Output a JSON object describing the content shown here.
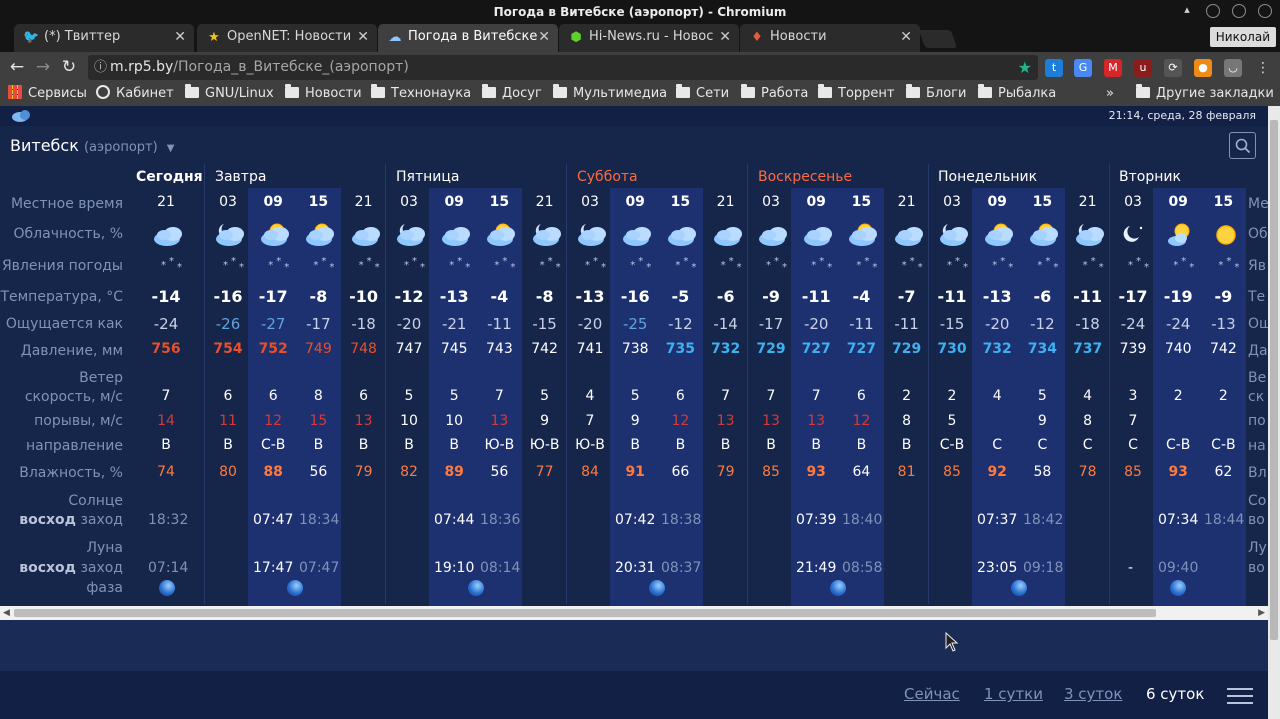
{
  "window": {
    "title": "Погода в Витебске (аэропорт) - Chromium"
  },
  "tabs": [
    {
      "label": "(*) Твиттер",
      "icon": "twitter-icon"
    },
    {
      "label": "OpenNET: Новости",
      "icon": "star-icon"
    },
    {
      "label": "Погода в Витебске",
      "icon": "weather-icon"
    },
    {
      "label": "Hi-News.ru - Новос",
      "icon": "hinews-icon"
    },
    {
      "label": "Новости",
      "icon": "rocket-icon"
    }
  ],
  "profile": {
    "name": "Николай"
  },
  "address": {
    "host": "m.rp5.by",
    "path": "/Погода_в_Витебске_(аэропорт)"
  },
  "bookmarks": {
    "apps": "Сервисы",
    "items": [
      "Кабинет",
      "GNU/Linux",
      "Новости",
      "Технонаука",
      "Досуг",
      "Мультимедиа",
      "Сети",
      "Работа",
      "Торрент",
      "Блоги",
      "Рыбалка"
    ],
    "more": "»",
    "other": "Другие закладки"
  },
  "page": {
    "datetime": "21:14, среда, 28 февраля",
    "city": "Витебск",
    "city_sub": "(аэропорт)",
    "labels": {
      "local_time": "Местное время",
      "clouds": "Облачность, %",
      "phenomena": "Явления погоды",
      "temperature": "Температура, °С",
      "feels": "Ощущается как",
      "pressure": "Давление, мм",
      "wind1": "Ветер",
      "wind2": "скорость, м/с",
      "gusts": "порывы, м/с",
      "direction": "направление",
      "humidity": "Влажность, %",
      "sun": "Солнце",
      "rise": "восход",
      "set": "заход",
      "moon": "Луна",
      "phase": "фаза"
    },
    "right_cut_labels": [
      "Ме",
      "Об",
      "Яв",
      "Те",
      "Ощ",
      "Да",
      "Ве",
      "ск",
      "по",
      "на",
      "Вл",
      "Со",
      "во",
      "Лу",
      "во"
    ]
  },
  "days": [
    {
      "name": "Сегодня",
      "weekend": false,
      "today": true,
      "sunrise": "",
      "sunset": "18:32",
      "moonrise": "",
      "moonset": "07:14",
      "slots": [
        {
          "h": "21",
          "t": "-14",
          "f": "-24",
          "p": "756",
          "w": "7",
          "g": "14",
          "d": "В",
          "hum": "74",
          "c": "cloudy"
        }
      ]
    },
    {
      "name": "Завтра",
      "weekend": false,
      "sunrise": "07:47",
      "sunset": "18:34",
      "moonrise": "17:47",
      "moonset": "07:47",
      "slots": [
        {
          "h": "03",
          "t": "-16",
          "f": "-26",
          "p": "754",
          "w": "6",
          "g": "11",
          "d": "В",
          "hum": "80",
          "c": "night-cloudy"
        },
        {
          "h": "09",
          "t": "-17",
          "f": "-27",
          "p": "752",
          "w": "6",
          "g": "12",
          "d": "С-В",
          "hum": "88",
          "c": "sun-cloud"
        },
        {
          "h": "15",
          "t": "-8",
          "f": "-17",
          "p": "749",
          "w": "8",
          "g": "15",
          "d": "В",
          "hum": "56",
          "c": "sun-cloud"
        },
        {
          "h": "21",
          "t": "-10",
          "f": "-18",
          "p": "748",
          "w": "6",
          "g": "13",
          "d": "В",
          "hum": "79",
          "c": "cloudy"
        }
      ]
    },
    {
      "name": "Пятница",
      "weekend": false,
      "sunrise": "07:44",
      "sunset": "18:36",
      "moonrise": "19:10",
      "moonset": "08:14",
      "slots": [
        {
          "h": "03",
          "t": "-12",
          "f": "-20",
          "p": "747",
          "w": "5",
          "g": "10",
          "d": "В",
          "hum": "82",
          "c": "night-cloudy"
        },
        {
          "h": "09",
          "t": "-13",
          "f": "-21",
          "p": "745",
          "w": "5",
          "g": "10",
          "d": "В",
          "hum": "89",
          "c": "cloudy"
        },
        {
          "h": "15",
          "t": "-4",
          "f": "-11",
          "p": "743",
          "w": "7",
          "g": "13",
          "d": "Ю-В",
          "hum": "56",
          "c": "sun-cloud"
        },
        {
          "h": "21",
          "t": "-8",
          "f": "-15",
          "p": "742",
          "w": "5",
          "g": "9",
          "d": "Ю-В",
          "hum": "77",
          "c": "night-cloudy"
        }
      ]
    },
    {
      "name": "Суббота",
      "weekend": true,
      "sunrise": "07:42",
      "sunset": "18:38",
      "moonrise": "20:31",
      "moonset": "08:37",
      "slots": [
        {
          "h": "03",
          "t": "-13",
          "f": "-20",
          "p": "741",
          "w": "4",
          "g": "7",
          "d": "Ю-В",
          "hum": "84",
          "c": "night-cloudy"
        },
        {
          "h": "09",
          "t": "-16",
          "f": "-25",
          "p": "738",
          "w": "5",
          "g": "9",
          "d": "В",
          "hum": "91",
          "c": "cloudy"
        },
        {
          "h": "15",
          "t": "-5",
          "f": "-12",
          "p": "735",
          "w": "6",
          "g": "12",
          "d": "В",
          "hum": "66",
          "c": "cloudy"
        },
        {
          "h": "21",
          "t": "-6",
          "f": "-14",
          "p": "732",
          "w": "7",
          "g": "13",
          "d": "В",
          "hum": "79",
          "c": "cloudy"
        }
      ]
    },
    {
      "name": "Воскресенье",
      "weekend": true,
      "sunrise": "07:39",
      "sunset": "18:40",
      "moonrise": "21:49",
      "moonset": "08:58",
      "slots": [
        {
          "h": "03",
          "t": "-9",
          "f": "-17",
          "p": "729",
          "w": "7",
          "g": "13",
          "d": "В",
          "hum": "85",
          "c": "cloudy"
        },
        {
          "h": "09",
          "t": "-11",
          "f": "-20",
          "p": "727",
          "w": "7",
          "g": "13",
          "d": "В",
          "hum": "93",
          "c": "cloudy"
        },
        {
          "h": "15",
          "t": "-4",
          "f": "-11",
          "p": "727",
          "w": "6",
          "g": "12",
          "d": "В",
          "hum": "64",
          "c": "sun-cloud"
        },
        {
          "h": "21",
          "t": "-7",
          "f": "-11",
          "p": "729",
          "w": "2",
          "g": "8",
          "d": "В",
          "hum": "81",
          "c": "cloudy"
        }
      ]
    },
    {
      "name": "Понедельник",
      "weekend": false,
      "sunrise": "07:37",
      "sunset": "18:42",
      "moonrise": "23:05",
      "moonset": "09:18",
      "slots": [
        {
          "h": "03",
          "t": "-11",
          "f": "-15",
          "p": "730",
          "w": "2",
          "g": "5",
          "d": "С-В",
          "hum": "85",
          "c": "night-cloudy"
        },
        {
          "h": "09",
          "t": "-13",
          "f": "-20",
          "p": "732",
          "w": "4",
          "g": "",
          "d": "С",
          "hum": "92",
          "c": "sun-cloud"
        },
        {
          "h": "15",
          "t": "-6",
          "f": "-12",
          "p": "734",
          "w": "5",
          "g": "9",
          "d": "С",
          "hum": "58",
          "c": "sun-cloud"
        },
        {
          "h": "21",
          "t": "-11",
          "f": "-18",
          "p": "737",
          "w": "4",
          "g": "8",
          "d": "С",
          "hum": "78",
          "c": "night-cloudy"
        }
      ]
    },
    {
      "name": "Вторник",
      "weekend": false,
      "sunrise": "07:34",
      "sunset": "18:44",
      "moonrise": "-",
      "moonset": "09:40",
      "slots": [
        {
          "h": "03",
          "t": "-17",
          "f": "-24",
          "p": "739",
          "w": "3",
          "g": "7",
          "d": "С",
          "hum": "85",
          "c": "night-clear"
        },
        {
          "h": "09",
          "t": "-19",
          "f": "-24",
          "p": "740",
          "w": "2",
          "g": "",
          "d": "С-В",
          "hum": "93",
          "c": "sun-small-cloud"
        },
        {
          "h": "15",
          "t": "-9",
          "f": "-13",
          "p": "742",
          "w": "2",
          "g": "",
          "d": "С-В",
          "hum": "62",
          "c": "sun"
        }
      ]
    }
  ],
  "footer": {
    "links": [
      "Сейчас",
      "1 сутки",
      "3 суток",
      "6 суток"
    ],
    "active_index": 3
  },
  "colors": {
    "background": "#16254a",
    "daylight_column": "#1d3170",
    "weekend_day": "#ff6a3d",
    "warm_red": "#e8502a",
    "gust_red": "#d7393a",
    "cold_blue": "#5fa3e0",
    "pressure_blue": "#3fb0f0",
    "humidity_orange": "#ff7a3c",
    "label_gray": "#7f92b8"
  }
}
